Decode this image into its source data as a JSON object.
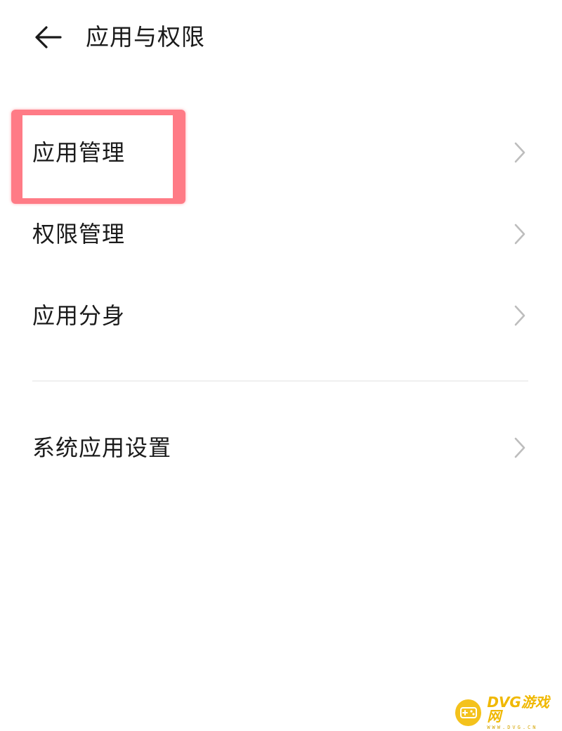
{
  "header": {
    "title": "应用与权限",
    "back_icon": "arrow-left-icon"
  },
  "menu": {
    "group1": [
      {
        "label": "应用管理",
        "highlighted": true
      },
      {
        "label": "权限管理",
        "highlighted": false
      },
      {
        "label": "应用分身",
        "highlighted": false
      }
    ],
    "group2": [
      {
        "label": "系统应用设置",
        "highlighted": false
      }
    ],
    "chevron_icon": "chevron-right-icon"
  },
  "watermark": {
    "brand": "DVG游戏网",
    "url": "WWW.DVG.CN"
  },
  "colors": {
    "text": "#1a1a1a",
    "chevron": "#bdbdbd",
    "divider": "#f0f0f0",
    "highlight": "#ff7b86",
    "watermark": "#f4c21c"
  }
}
